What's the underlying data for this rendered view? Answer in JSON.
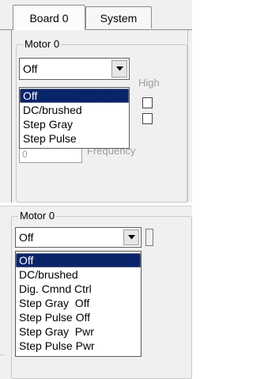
{
  "top": {
    "tabs": [
      {
        "label": "Board 0",
        "active": true
      },
      {
        "label": "System",
        "active": false
      }
    ],
    "group_title": "Motor 0",
    "combo_value": "Off",
    "options": [
      "Off",
      "DC/brushed",
      "Step Gray",
      "Step Pulse"
    ],
    "selected_index": 0,
    "background": {
      "high_label": "High",
      "frequency_label": "Frequency",
      "textbox_value": "0"
    }
  },
  "bottom": {
    "group_title": "Motor 0",
    "combo_value": "Off",
    "options": [
      "Off",
      "DC/brushed",
      "Dig. Cmnd Ctrl",
      "Step Gray  Off",
      "Step Pulse Off",
      "Step Gray  Pwr",
      "Step Pulse Pwr"
    ],
    "selected_index": 0
  },
  "colors": {
    "selection": "#0a246a",
    "window": "#f0f0f0"
  },
  "icons": {
    "combo_arrow": "chevron-down-icon"
  }
}
